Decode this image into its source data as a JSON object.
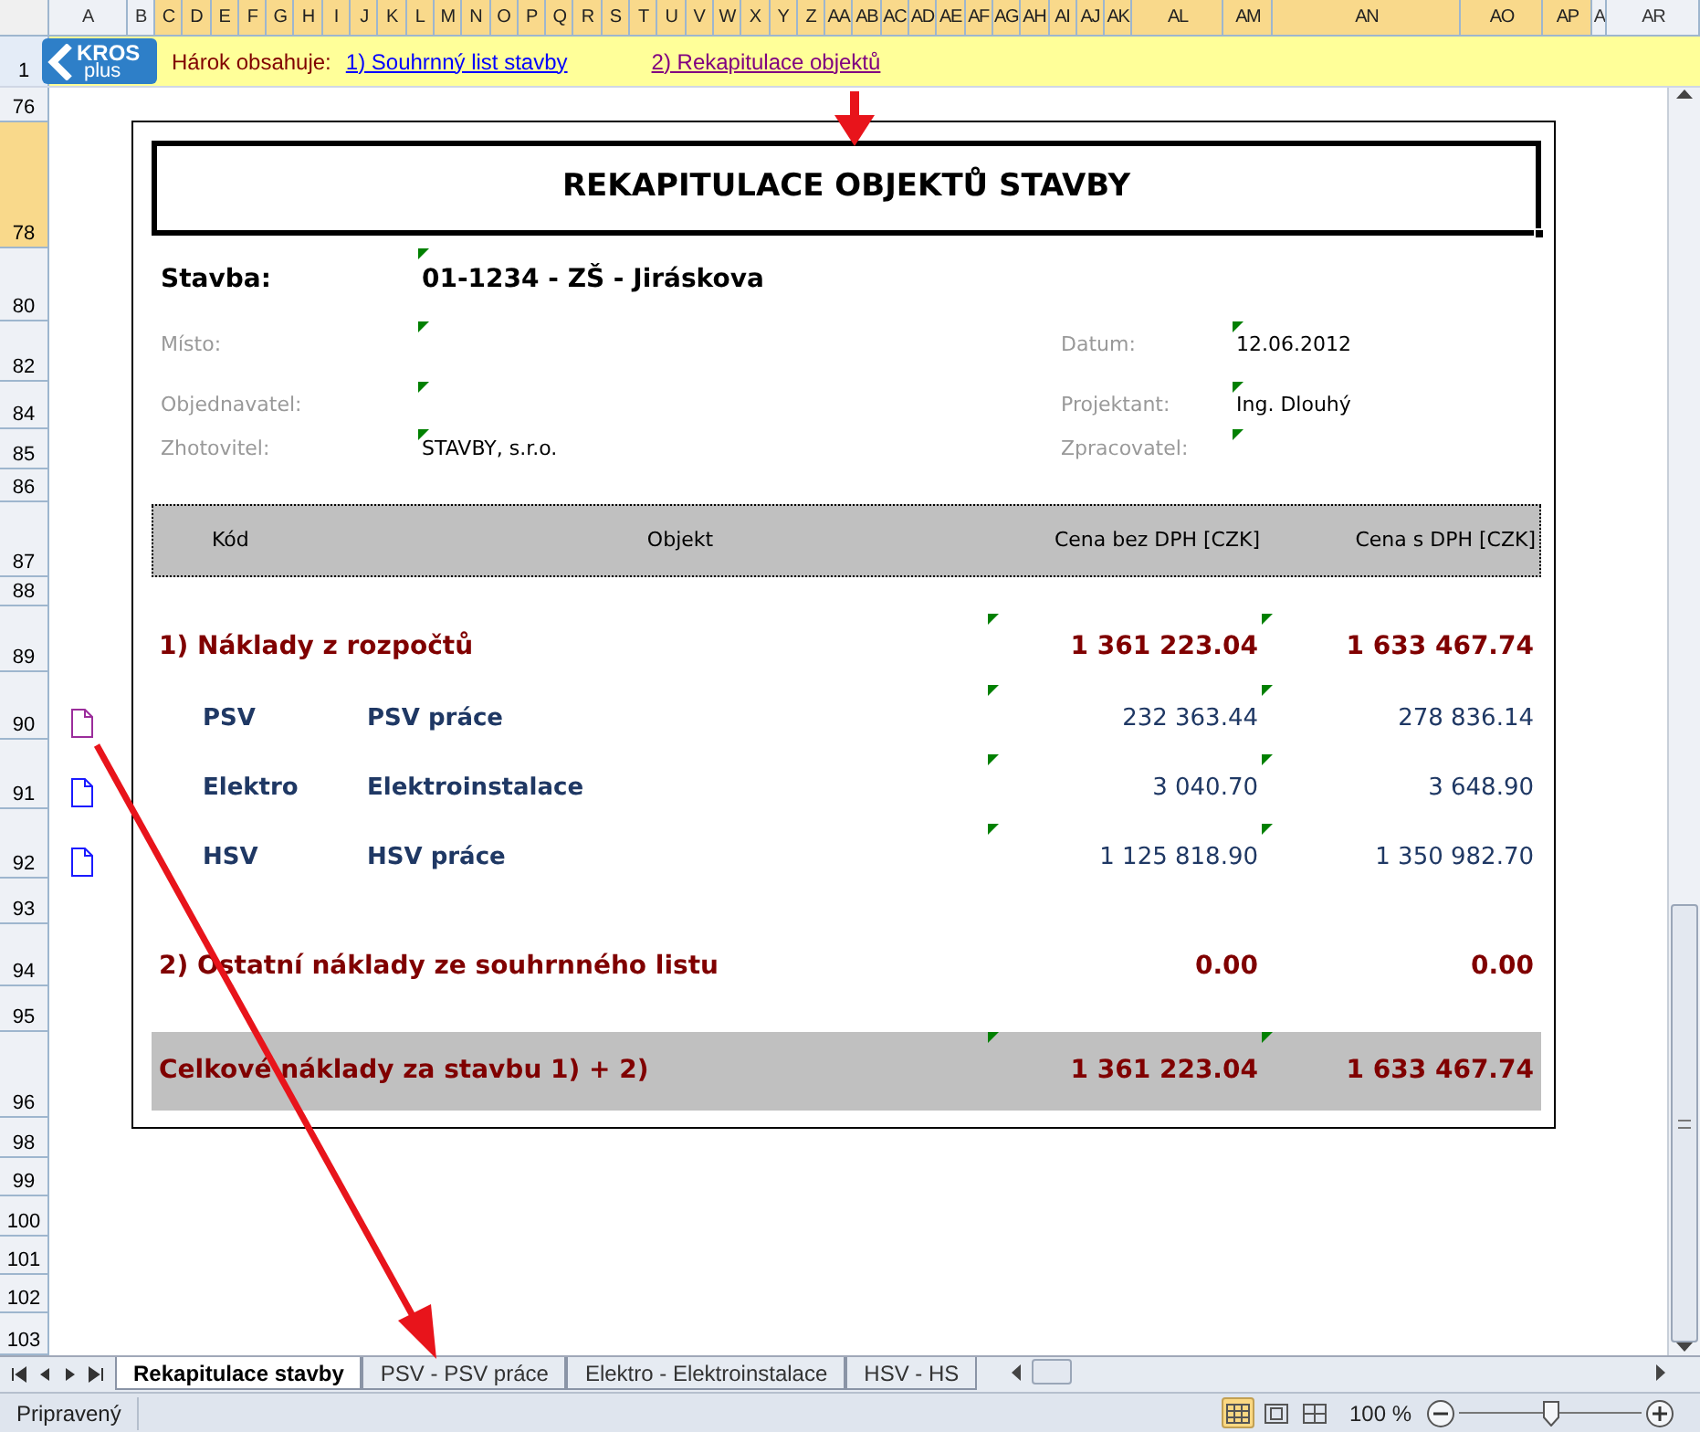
{
  "columns": [
    {
      "label": "A",
      "selected": false
    },
    {
      "label": "B",
      "selected": false
    },
    {
      "label": "C",
      "selected": true
    },
    {
      "label": "D",
      "selected": true
    },
    {
      "label": "E",
      "selected": true
    },
    {
      "label": "F",
      "selected": true
    },
    {
      "label": "G",
      "selected": true
    },
    {
      "label": "H",
      "selected": true
    },
    {
      "label": "I",
      "selected": true
    },
    {
      "label": "J",
      "selected": true
    },
    {
      "label": "K",
      "selected": true
    },
    {
      "label": "L",
      "selected": true
    },
    {
      "label": "M",
      "selected": true
    },
    {
      "label": "N",
      "selected": true
    },
    {
      "label": "O",
      "selected": true
    },
    {
      "label": "P",
      "selected": true
    },
    {
      "label": "Q",
      "selected": true
    },
    {
      "label": "R",
      "selected": true
    },
    {
      "label": "S",
      "selected": true
    },
    {
      "label": "T",
      "selected": true
    },
    {
      "label": "U",
      "selected": true
    },
    {
      "label": "V",
      "selected": true
    },
    {
      "label": "W",
      "selected": true
    },
    {
      "label": "X",
      "selected": true
    },
    {
      "label": "Y",
      "selected": true
    },
    {
      "label": "Z",
      "selected": true
    },
    {
      "label": "AA",
      "selected": true
    },
    {
      "label": "AB",
      "selected": true
    },
    {
      "label": "AC",
      "selected": true
    },
    {
      "label": "AD",
      "selected": true
    },
    {
      "label": "AE",
      "selected": true
    },
    {
      "label": "AF",
      "selected": true
    },
    {
      "label": "AG",
      "selected": true
    },
    {
      "label": "AH",
      "selected": true
    },
    {
      "label": "AI",
      "selected": true
    },
    {
      "label": "AJ",
      "selected": true
    },
    {
      "label": "AK",
      "selected": true
    },
    {
      "label": "AL",
      "selected": true
    },
    {
      "label": "AM",
      "selected": true
    },
    {
      "label": "AN",
      "selected": true
    },
    {
      "label": "AO",
      "selected": true
    },
    {
      "label": "AP",
      "selected": true
    },
    {
      "label": "A",
      "selected": false
    },
    {
      "label": "AR",
      "selected": false
    }
  ],
  "banner": {
    "row": "1",
    "logo": {
      "line1": "KROS",
      "line2": "plus"
    },
    "label": "Hárok obsahuje:",
    "links": [
      {
        "text": "1) Souhrnný list stavby",
        "visited": false
      },
      {
        "text": "2) Rekapitulace objektů",
        "visited": true
      }
    ]
  },
  "rows": [
    {
      "label": "76",
      "selected": false
    },
    {
      "label": "78",
      "selected": true
    },
    {
      "label": "80",
      "selected": false
    },
    {
      "label": "82",
      "selected": false
    },
    {
      "label": "84",
      "selected": false
    },
    {
      "label": "85",
      "selected": false
    },
    {
      "label": "86",
      "selected": false
    },
    {
      "label": "87",
      "selected": false
    },
    {
      "label": "88",
      "selected": false
    },
    {
      "label": "89",
      "selected": false
    },
    {
      "label": "90",
      "selected": false
    },
    {
      "label": "91",
      "selected": false
    },
    {
      "label": "92",
      "selected": false
    },
    {
      "label": "93",
      "selected": false
    },
    {
      "label": "94",
      "selected": false
    },
    {
      "label": "95",
      "selected": false
    },
    {
      "label": "96",
      "selected": false
    },
    {
      "label": "98",
      "selected": false
    },
    {
      "label": "99",
      "selected": false
    },
    {
      "label": "100",
      "selected": false
    },
    {
      "label": "101",
      "selected": false
    },
    {
      "label": "102",
      "selected": false
    },
    {
      "label": "103",
      "selected": false
    }
  ],
  "document": {
    "title": "REKAPITULACE OBJEKTŮ STAVBY",
    "project": {
      "label": "Stavba:",
      "value": "01-1234 - ZŠ - Jiráskova",
      "flagged": true
    },
    "fields": [
      {
        "left": {
          "label": "Místo:",
          "flagged": true
        },
        "right": {
          "label": "Datum:",
          "value": "12.06.2012",
          "flagged": true
        }
      },
      {
        "left": {
          "label": "Objednavatel:",
          "flagged": true
        },
        "right": {
          "label": "Projektant:",
          "value": "Ing. Dlouhý",
          "flagged": true
        }
      },
      {
        "left": {
          "label": "Zhotovitel:",
          "value": "STAVBY, s.r.o.",
          "flagged": true
        },
        "right": {
          "label": "Zpracovatel:",
          "flagged": true
        }
      }
    ],
    "table": {
      "columns": [
        "Kód",
        "Objekt",
        "Cena bez DPH [CZK]",
        "Cena s DPH [CZK]"
      ],
      "rows": [
        {
          "kind": "section",
          "title": "1) Náklady z rozpočtů",
          "price": "1 361 223.04",
          "price_vat": "1 633 467.74",
          "flagged": true
        },
        {
          "kind": "item",
          "code": "PSV",
          "name": "PSV práce",
          "price": "232 363.44",
          "price_vat": "278 836.14",
          "flagged": true,
          "link_visited": true
        },
        {
          "kind": "item",
          "code": "Elektro",
          "name": "Elektroinstalace",
          "price": "3 040.70",
          "price_vat": "3 648.90",
          "flagged": true,
          "link_visited": false
        },
        {
          "kind": "item",
          "code": "HSV",
          "name": "HSV práce",
          "price": "1 125 818.90",
          "price_vat": "1 350 982.70",
          "flagged": true,
          "link_visited": false
        },
        {
          "kind": "section",
          "title": "2) Ostatní náklady ze souhrnného listu",
          "price": "0.00",
          "price_vat": "0.00",
          "flagged": false
        },
        {
          "kind": "total",
          "title": "Celkové náklady za stavbu 1) + 2)",
          "price": "1 361 223.04",
          "price_vat": "1 633 467.74",
          "flagged": true
        }
      ]
    }
  },
  "sheet_tabs": [
    {
      "label": "Rekapitulace stavby",
      "selected": true
    },
    {
      "label": "PSV - PSV práce",
      "selected": false
    },
    {
      "label": "Elektro - Elektroinstalace",
      "selected": false
    },
    {
      "label": "HSV - HS",
      "selected": false
    }
  ],
  "status_bar": {
    "text": "Pripravený",
    "views": [
      {
        "kind": "normal",
        "selected": true
      },
      {
        "kind": "page_layout",
        "selected": false
      },
      {
        "kind": "page_break",
        "selected": false
      }
    ],
    "zoom": "100 %",
    "zoom_slider": {
      "level": 0.5
    }
  }
}
